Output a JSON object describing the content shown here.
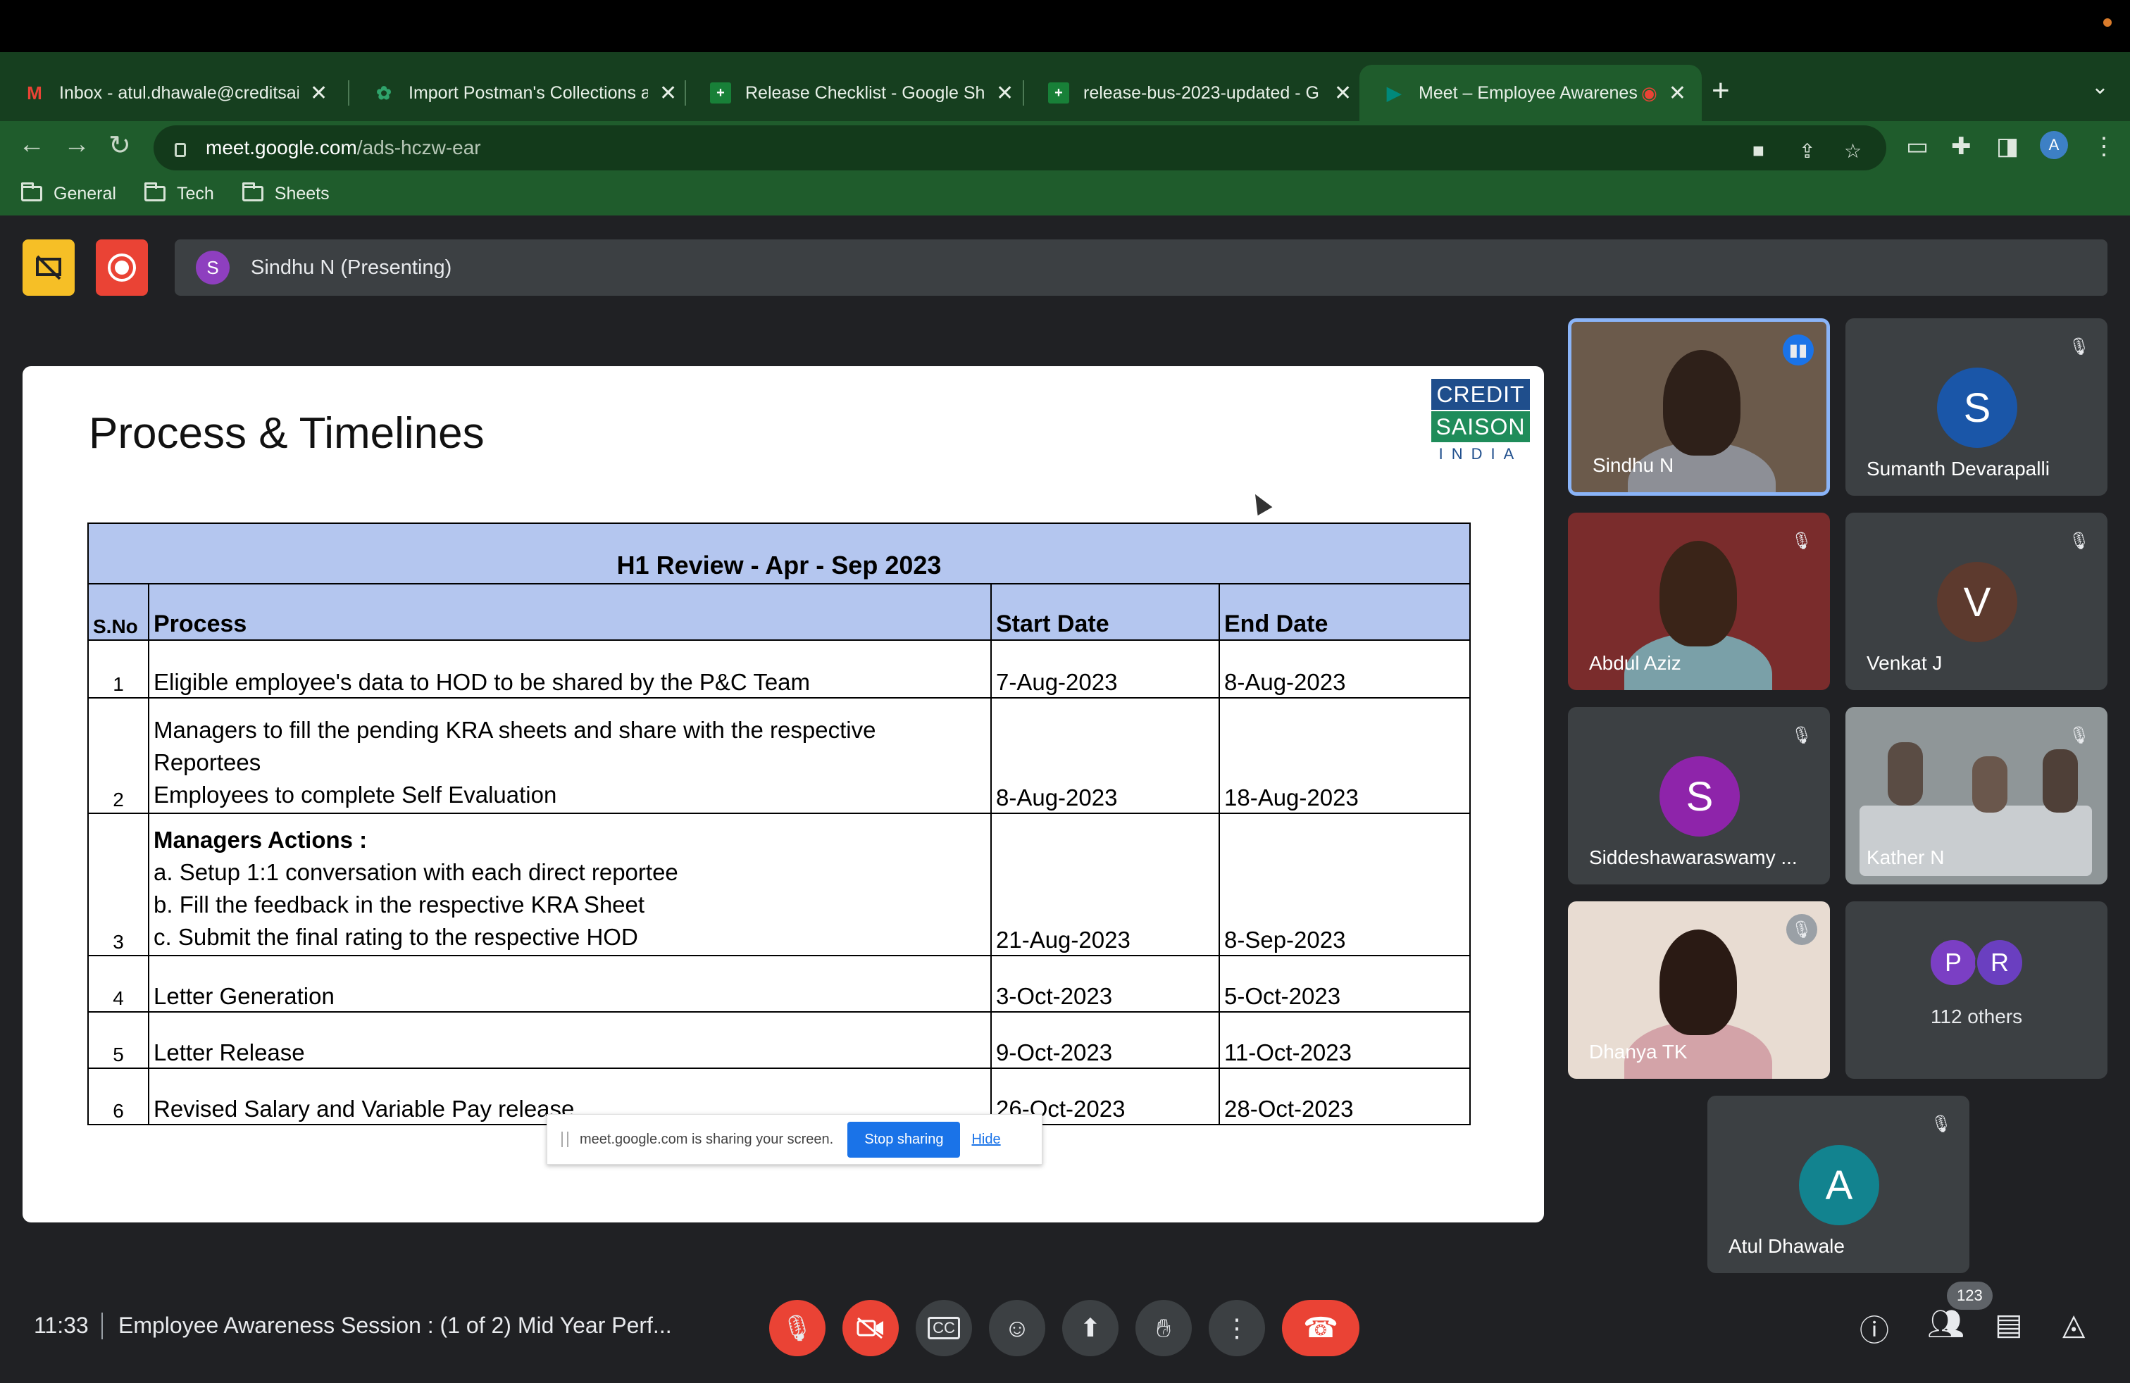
{
  "browser": {
    "tabs": [
      {
        "label": "Inbox - atul.dhawale@creditsai",
        "icon": "gmail-icon",
        "color": "#ea4335"
      },
      {
        "label": "Import Postman's Collections a",
        "icon": "gear-icon",
        "color": "#2fa36b"
      },
      {
        "label": "Release Checklist - Google She",
        "icon": "sheets-icon",
        "color": "#188038"
      },
      {
        "label": "release-bus-2023-updated - G",
        "icon": "sheets-icon",
        "color": "#188038"
      },
      {
        "label": "Meet – Employee Awarenes",
        "icon": "meet-icon",
        "color": "#00897b"
      }
    ],
    "url_host": "meet.google.com",
    "url_path": "/ads-hczw-ear",
    "profile_initial": "A",
    "bookmarks": [
      "General",
      "Tech",
      "Sheets"
    ]
  },
  "meet": {
    "presenting_initial": "S",
    "presenting_text": "Sindhu N (Presenting)",
    "time": "11:33",
    "title": "Employee Awareness Session : (1 of 2) Mid Year Perf...",
    "participant_count": "123"
  },
  "slide": {
    "title": "Process & Timelines",
    "logo": {
      "line1": "CREDIT",
      "line2": "SAISON",
      "line3": "INDIA"
    },
    "table": {
      "heading": "H1 Review -  Apr - Sep 2023",
      "columns": [
        "S.No",
        "Process",
        "Start Date",
        "End Date"
      ],
      "rows": [
        {
          "no": "1",
          "lines": [
            "Eligible employee's data to HOD to be shared by the P&C Team"
          ],
          "start": "7-Aug-2023",
          "end": "8-Aug-2023"
        },
        {
          "no": "2",
          "lines": [
            "Managers to fill the pending KRA sheets and share with the respective",
            "Reportees",
            "Employees to complete Self Evaluation"
          ],
          "start": "8-Aug-2023",
          "end": "18-Aug-2023"
        },
        {
          "no": "3",
          "bold_line": "Managers Actions :",
          "lines": [
            "a. Setup 1:1 conversation with each direct reportee",
            "b. Fill the feedback in the respective KRA Sheet",
            "c. Submit the final rating to the respective HOD"
          ],
          "start": "21-Aug-2023",
          "end": "8-Sep-2023"
        },
        {
          "no": "4",
          "lines": [
            "Letter Generation"
          ],
          "start": "3-Oct-2023",
          "end": "5-Oct-2023"
        },
        {
          "no": "5",
          "lines": [
            "Letter Release"
          ],
          "start": "9-Oct-2023",
          "end": "11-Oct-2023"
        },
        {
          "no": "6",
          "lines": [
            "Revised Salary and Variable Pay release"
          ],
          "start": "26-Oct-2023",
          "end": "28-Oct-2023"
        }
      ]
    },
    "share_bar": {
      "text": "meet.google.com is sharing your screen.",
      "stop": "Stop sharing",
      "hide": "Hide"
    }
  },
  "participants": [
    {
      "name": "Sindhu N",
      "type": "video",
      "speaking": true
    },
    {
      "name": "Sumanth Devarapalli",
      "initial": "S",
      "color": "#1a56a8",
      "muted": true
    },
    {
      "name": "Abdul Aziz",
      "type": "video",
      "muted": true
    },
    {
      "name": "Venkat J",
      "initial": "V",
      "color": "#5d3a2e",
      "muted": true
    },
    {
      "name": "Siddeshawaraswamy ...",
      "initial": "S",
      "color": "#8e24aa",
      "muted": true
    },
    {
      "name": "Kather N",
      "type": "video",
      "muted": true
    },
    {
      "name": "Dhanya TK",
      "type": "video",
      "muted": true
    },
    {
      "others_label": "112 others",
      "initials": [
        "P",
        "R"
      ],
      "colors": [
        "#7b3fc4",
        "#6a3fc0"
      ]
    },
    {
      "name": "Atul Dhawale",
      "initial": "A",
      "color": "#12838f",
      "muted": true
    }
  ]
}
